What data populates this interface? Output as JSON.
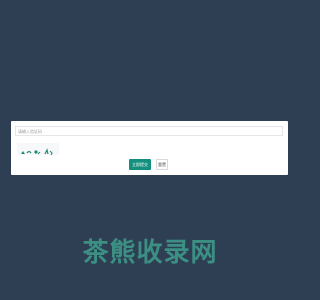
{
  "form": {
    "code_placeholder": "请输入验证码",
    "submit_label": "立即提交",
    "reset_label": "重置"
  },
  "watermark": {
    "text": "茶熊收录网"
  },
  "colors": {
    "page_background": "#2e3e53",
    "accent": "#14907e",
    "watermark": "#3f9f8c"
  },
  "icons": {
    "captcha": "captcha-image"
  }
}
